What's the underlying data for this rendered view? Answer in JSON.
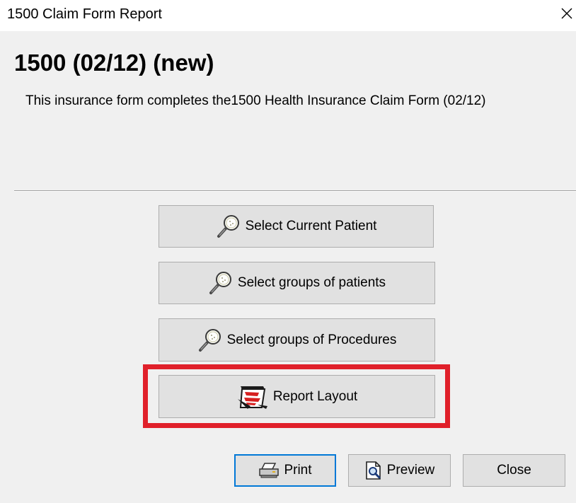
{
  "window": {
    "title": "1500 Claim Form Report",
    "close_icon": "close-icon"
  },
  "header": {
    "form_title": "1500 (02/12) (new)",
    "description": "This insurance form completes the1500 Health Insurance Claim Form (02/12)"
  },
  "actions": {
    "select_current_patient": "Select Current Patient",
    "select_groups_of_patients": "Select groups of patients",
    "select_groups_of_procedures": "Select groups of Procedures",
    "report_layout": "Report Layout"
  },
  "footer": {
    "print": "Print",
    "preview": "Preview",
    "close": "Close"
  },
  "icons": {
    "search": "magnifier-icon",
    "report_layout": "report-layout-icon",
    "print": "printer-icon",
    "preview": "preview-icon"
  },
  "colors": {
    "highlight": "#e0202a",
    "default_button_border": "#0078d7",
    "button_face": "#e1e1e1",
    "dialog_background": "#f0f0f0"
  }
}
